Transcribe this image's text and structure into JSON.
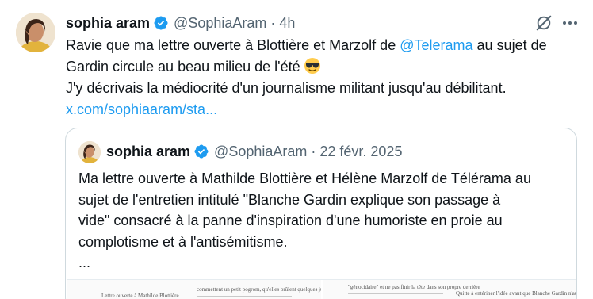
{
  "tweet": {
    "author_name": "sophia aram",
    "handle": "@SophiaAram",
    "time": "4h",
    "lines": [
      "Ravie que ma lettre ouverte à Blottière et Marzolf de ",
      "@Telerama",
      " au sujet de",
      "Gardin circule au beau milieu de l'été",
      "J'y décrivais la médiocrité d'un journalisme militant jusqu'au débilitant.",
      "x.com/sophiaaram/sta..."
    ],
    "emoji": "sunglasses-emoji"
  },
  "quoted": {
    "author_name": "sophia aram",
    "handle": "@SophiaAram",
    "date": "22 févr. 2025",
    "lines": [
      "Ma lettre ouverte à Mathilde Blottière et Hélène Marzolf de Télérama au",
      "sujet de l'entretien intitulé \"Blanche Gardin explique son passage à",
      "vide\" consacré à la panne d'inspiration d'une humoriste en proie au",
      "complotisme et à l'antisémitisme.",
      "..."
    ],
    "doc_snippets": [
      "Lettre ouverte à Mathilde Blottière",
      "commettent un petit pogrom, qu'elles brûlent quelques juifs",
      "\"génocidaire\" et ne pas finir la tête dans son propre derrière",
      "Quitte à entériner l'idée avant que Blanche Gardin n'aurait"
    ]
  },
  "icons": {
    "verified": "verified-badge-icon",
    "grok": "grok-icon",
    "more": "more-icon"
  },
  "colors": {
    "link": "#1d9bf0",
    "secondary_text": "#536471",
    "border": "#cfd9de",
    "verified": "#1d9bf0"
  }
}
